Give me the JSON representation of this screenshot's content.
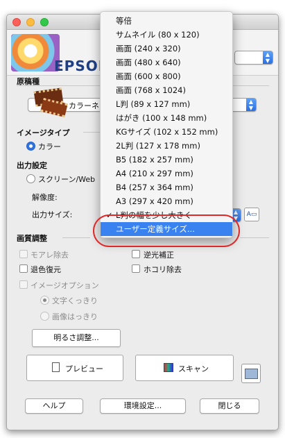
{
  "banner": {
    "brand": "EPSON"
  },
  "document_type": {
    "label": "原稿種",
    "value": "カラーネ"
  },
  "image_type": {
    "label": "イメージタイプ",
    "option": "カラー"
  },
  "output_settings": {
    "label": "出力設定",
    "destination": "スクリーン/Web",
    "resolution_label": "解像度:",
    "output_size_label": "出力サイズ:"
  },
  "size_menu": {
    "items": [
      "等倍",
      "サムネイル (80 x 120)",
      "画面 (240 x 320)",
      "画面 (480 x 640)",
      "画面 (600 x 800)",
      "画面 (768 x 1024)",
      "L判 (89 x 127 mm)",
      "はがき (100 x 148 mm)",
      "KGサイズ (102 x 152 mm)",
      "2L判 (127 x 178 mm)",
      "B5 (182 x 257 mm)",
      "A4 (210 x 297 mm)",
      "B4 (257 x 364 mm)",
      "A3 (297 x 420 mm)"
    ],
    "checked_item": "L判の幅を少し大きく",
    "highlighted_item": "ユーザー定義サイズ..."
  },
  "adjustments": {
    "label": "画質調整",
    "moire": "モアレ除去",
    "backlight": "逆光補正",
    "color_restore": "退色復元",
    "dust": "ホコリ除去",
    "image_option": "イメージオプション",
    "text_sharp": "文字くっきり",
    "image_sharp": "画像はっきり",
    "brightness_button": "明るさ調整..."
  },
  "actions": {
    "preview": "プレビュー",
    "scan": "スキャン",
    "help": "ヘルプ",
    "preferences": "環境設定...",
    "close": "閉じる"
  }
}
